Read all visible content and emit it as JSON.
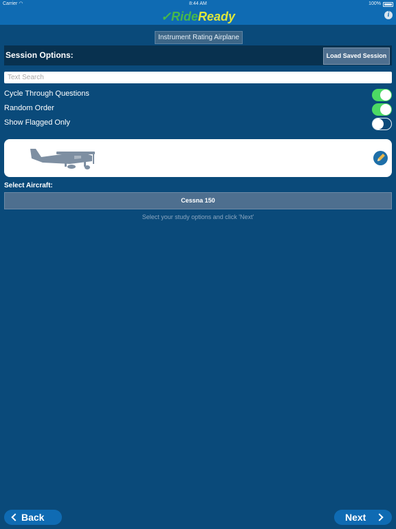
{
  "status_bar": {
    "carrier": "Carrier",
    "time": "8:44 AM",
    "battery": "100%"
  },
  "header": {
    "logo_check": "✓",
    "logo_ride": "Ride",
    "logo_ready": "Ready",
    "info_glyph": "i"
  },
  "subject": "Instrument Rating Airplane",
  "session": {
    "title": "Session Options:",
    "load_label": "Load Saved Session"
  },
  "search": {
    "placeholder": "Text Search",
    "value": ""
  },
  "options": [
    {
      "label": "Cycle Through Questions",
      "enabled": true
    },
    {
      "label": "Random Order",
      "enabled": true
    },
    {
      "label": "Show Flagged Only",
      "enabled": false
    }
  ],
  "aircraft": {
    "select_label": "Select Aircraft:",
    "selected": "Cessna 150",
    "image_icon": "airplane-icon",
    "edit_icon": "pencil-icon"
  },
  "hint": "Select your study options and click 'Next'",
  "footer": {
    "back_label": "Back",
    "next_label": "Next"
  },
  "colors": {
    "background": "#0a4a7a",
    "header": "#0f6bb3",
    "toggle_on": "#4cd964",
    "logo_green": "#47b84b",
    "logo_yellow": "#dfe63a"
  }
}
